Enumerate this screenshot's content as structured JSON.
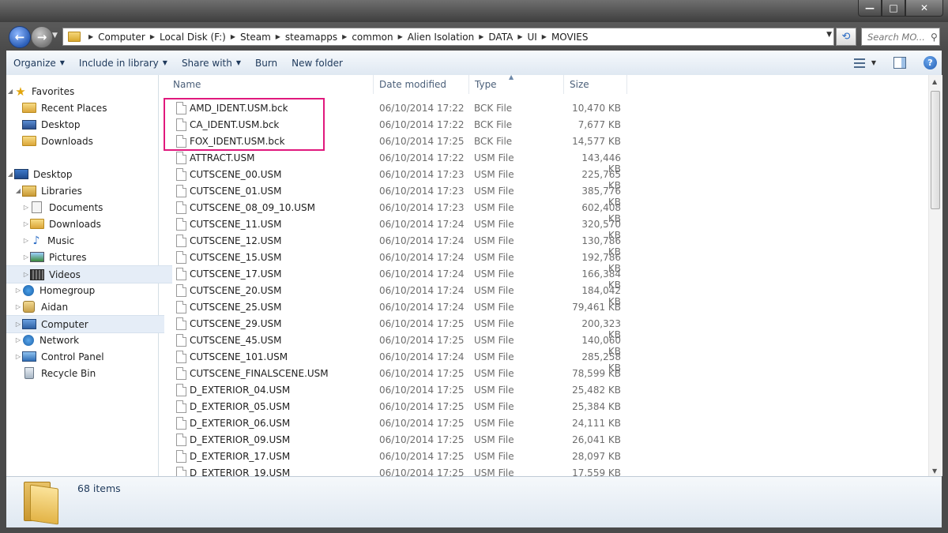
{
  "window": {
    "title": "",
    "controls": {
      "minimize": "—",
      "maximize": "□",
      "close": "✕"
    }
  },
  "address": {
    "crumbs": [
      "Computer",
      "Local Disk (F:)",
      "Steam",
      "steamapps",
      "common",
      "Alien Isolation",
      "DATA",
      "UI",
      "MOVIES"
    ],
    "search_placeholder": "Search MO..."
  },
  "toolbar": {
    "organize": "Organize",
    "include_in_library": "Include in library",
    "share_with": "Share with",
    "burn": "Burn",
    "new_folder": "New folder"
  },
  "nav": {
    "favorites": "Favorites",
    "recent_places": "Recent Places",
    "desktop_fav": "Desktop",
    "downloads_fav": "Downloads",
    "desktop": "Desktop",
    "libraries": "Libraries",
    "documents": "Documents",
    "downloads": "Downloads",
    "music": "Music",
    "pictures": "Pictures",
    "videos": "Videos",
    "homegroup": "Homegroup",
    "user": "Aidan",
    "computer": "Computer",
    "network": "Network",
    "control_panel": "Control Panel",
    "recycle_bin": "Recycle Bin"
  },
  "columns": {
    "name": "Name",
    "date": "Date modified",
    "type": "Type",
    "size": "Size"
  },
  "files": [
    {
      "name": "AMD_IDENT.USM.bck",
      "date": "06/10/2014 17:22",
      "type": "BCK File",
      "size": "10,470 KB"
    },
    {
      "name": "CA_IDENT.USM.bck",
      "date": "06/10/2014 17:22",
      "type": "BCK File",
      "size": "7,677 KB"
    },
    {
      "name": "FOX_IDENT.USM.bck",
      "date": "06/10/2014 17:25",
      "type": "BCK File",
      "size": "14,577 KB"
    },
    {
      "name": "ATTRACT.USM",
      "date": "06/10/2014 17:22",
      "type": "USM File",
      "size": "143,446 KB"
    },
    {
      "name": "CUTSCENE_00.USM",
      "date": "06/10/2014 17:23",
      "type": "USM File",
      "size": "225,765 KB"
    },
    {
      "name": "CUTSCENE_01.USM",
      "date": "06/10/2014 17:23",
      "type": "USM File",
      "size": "385,776 KB"
    },
    {
      "name": "CUTSCENE_08_09_10.USM",
      "date": "06/10/2014 17:23",
      "type": "USM File",
      "size": "602,408 KB"
    },
    {
      "name": "CUTSCENE_11.USM",
      "date": "06/10/2014 17:24",
      "type": "USM File",
      "size": "320,570 KB"
    },
    {
      "name": "CUTSCENE_12.USM",
      "date": "06/10/2014 17:24",
      "type": "USM File",
      "size": "130,786 KB"
    },
    {
      "name": "CUTSCENE_15.USM",
      "date": "06/10/2014 17:24",
      "type": "USM File",
      "size": "192,786 KB"
    },
    {
      "name": "CUTSCENE_17.USM",
      "date": "06/10/2014 17:24",
      "type": "USM File",
      "size": "166,384 KB"
    },
    {
      "name": "CUTSCENE_20.USM",
      "date": "06/10/2014 17:24",
      "type": "USM File",
      "size": "184,042 KB"
    },
    {
      "name": "CUTSCENE_25.USM",
      "date": "06/10/2014 17:24",
      "type": "USM File",
      "size": "79,461 KB"
    },
    {
      "name": "CUTSCENE_29.USM",
      "date": "06/10/2014 17:25",
      "type": "USM File",
      "size": "200,323 KB"
    },
    {
      "name": "CUTSCENE_45.USM",
      "date": "06/10/2014 17:25",
      "type": "USM File",
      "size": "140,060 KB"
    },
    {
      "name": "CUTSCENE_101.USM",
      "date": "06/10/2014 17:24",
      "type": "USM File",
      "size": "285,258 KB"
    },
    {
      "name": "CUTSCENE_FINALSCENE.USM",
      "date": "06/10/2014 17:25",
      "type": "USM File",
      "size": "78,599 KB"
    },
    {
      "name": "D_EXTERIOR_04.USM",
      "date": "06/10/2014 17:25",
      "type": "USM File",
      "size": "25,482 KB"
    },
    {
      "name": "D_EXTERIOR_05.USM",
      "date": "06/10/2014 17:25",
      "type": "USM File",
      "size": "25,384 KB"
    },
    {
      "name": "D_EXTERIOR_06.USM",
      "date": "06/10/2014 17:25",
      "type": "USM File",
      "size": "24,111 KB"
    },
    {
      "name": "D_EXTERIOR_09.USM",
      "date": "06/10/2014 17:25",
      "type": "USM File",
      "size": "26,041 KB"
    },
    {
      "name": "D_EXTERIOR_17.USM",
      "date": "06/10/2014 17:25",
      "type": "USM File",
      "size": "28,097 KB"
    },
    {
      "name": "D_EXTERIOR_19.USM",
      "date": "06/10/2014 17:25",
      "type": "USM File",
      "size": "17,559 KB"
    }
  ],
  "status": {
    "item_count": "68 items"
  },
  "colors": {
    "highlight": "#e0197d",
    "accent": "#1e395b"
  },
  "icons": [
    "back-arrow-icon",
    "forward-arrow-icon",
    "folder-icon",
    "refresh-icon",
    "search-icon",
    "view-options-icon",
    "preview-pane-icon",
    "help-icon",
    "star-icon",
    "file-icon"
  ]
}
